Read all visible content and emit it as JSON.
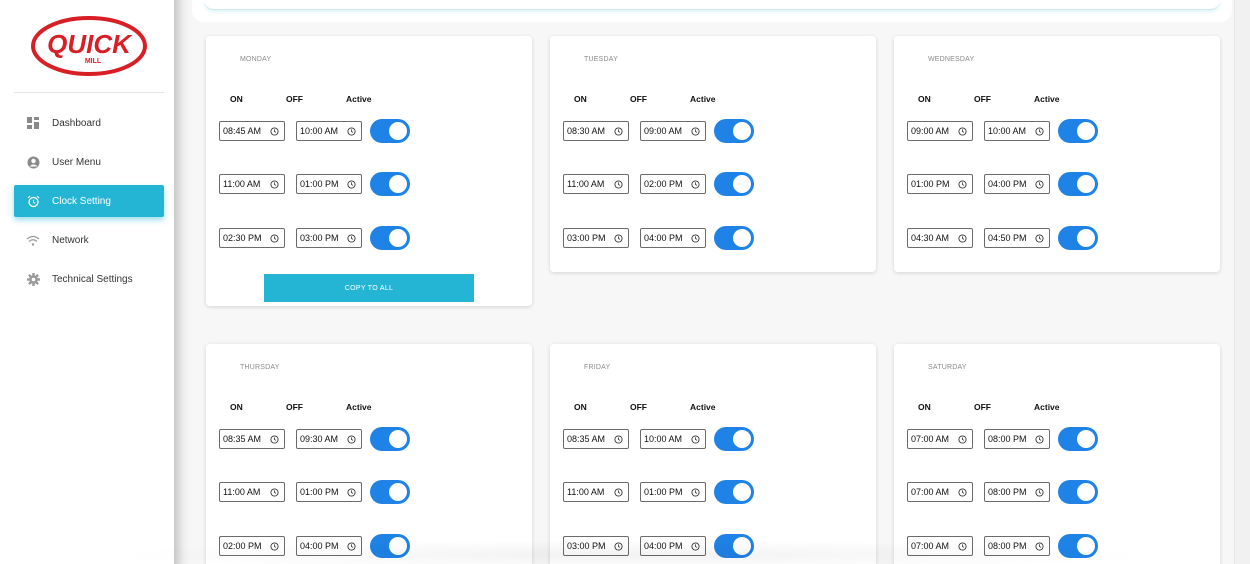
{
  "brand": {
    "name": "QUICK",
    "sub": "MILL"
  },
  "sidebar": {
    "items": [
      {
        "label": "Dashboard",
        "icon": "dashboard-icon",
        "active": false
      },
      {
        "label": "User Menu",
        "icon": "user-icon",
        "active": false
      },
      {
        "label": "Clock Setting",
        "icon": "alarm-clock-icon",
        "active": true
      },
      {
        "label": "Network",
        "icon": "wifi-icon",
        "active": false
      },
      {
        "label": "Technical Settings",
        "icon": "gear-icon",
        "active": false
      }
    ]
  },
  "headers": {
    "on": "ON",
    "off": "OFF",
    "active": "Active"
  },
  "copy_button": "COPY TO ALL",
  "days": [
    {
      "name": "MONDAY",
      "slots": [
        {
          "on": "08:45 AM",
          "off": "10:00 AM",
          "active": true
        },
        {
          "on": "11:00 AM",
          "off": "01:00 PM",
          "active": true
        },
        {
          "on": "02:30 PM",
          "off": "03:00 PM",
          "active": true
        }
      ]
    },
    {
      "name": "TUESDAY",
      "slots": [
        {
          "on": "08:30 AM",
          "off": "09:00 AM",
          "active": true
        },
        {
          "on": "11:00 AM",
          "off": "02:00 PM",
          "active": true
        },
        {
          "on": "03:00 PM",
          "off": "04:00 PM",
          "active": true
        }
      ]
    },
    {
      "name": "WEDNESDAY",
      "slots": [
        {
          "on": "09:00 AM",
          "off": "10:00 AM",
          "active": true
        },
        {
          "on": "01:00 PM",
          "off": "04:00 PM",
          "active": true
        },
        {
          "on": "04:30 AM",
          "off": "04:50 PM",
          "active": true
        }
      ]
    },
    {
      "name": "THURSDAY",
      "slots": [
        {
          "on": "08:35 AM",
          "off": "09:30 AM",
          "active": true
        },
        {
          "on": "11:00 AM",
          "off": "01:00 PM",
          "active": true
        },
        {
          "on": "02:00 PM",
          "off": "04:00 PM",
          "active": true
        }
      ]
    },
    {
      "name": "FRIDAY",
      "slots": [
        {
          "on": "08:35 AM",
          "off": "10:00 AM",
          "active": true
        },
        {
          "on": "11:00 AM",
          "off": "01:00 PM",
          "active": true
        },
        {
          "on": "03:00 PM",
          "off": "04:00 PM",
          "active": true
        }
      ]
    },
    {
      "name": "SATURDAY",
      "slots": [
        {
          "on": "07:00 AM",
          "off": "08:00 PM",
          "active": true
        },
        {
          "on": "07:00 AM",
          "off": "08:00 PM",
          "active": true
        },
        {
          "on": "07:00 AM",
          "off": "08:00 PM",
          "active": true
        }
      ]
    }
  ],
  "colors": {
    "accent": "#24b5d4",
    "toggle": "#1f82e6",
    "brand_red": "#d91f26"
  }
}
